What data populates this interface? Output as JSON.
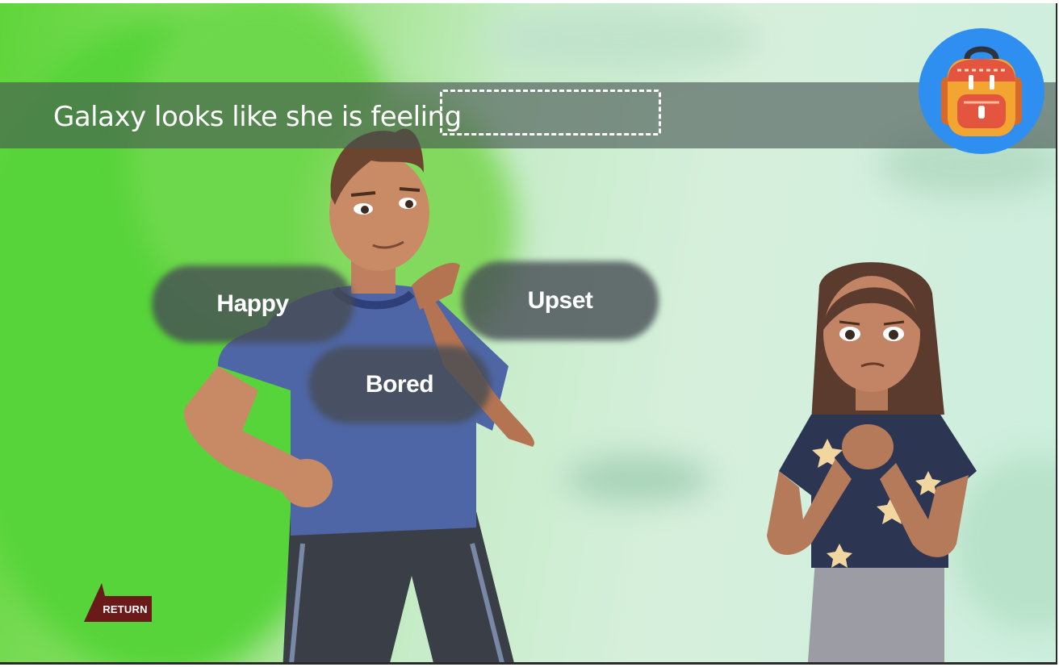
{
  "prompt": {
    "text": "Galaxy looks like she is feeling"
  },
  "choices": [
    {
      "label": "Happy"
    },
    {
      "label": "Upset"
    },
    {
      "label": "Bored"
    }
  ],
  "navigation": {
    "return_label": "RETURN"
  },
  "icons": {
    "backpack": "backpack-icon",
    "return": "return-arrow-icon"
  },
  "colors": {
    "prompt_bar": "#46544f",
    "choice_pill": "#464c54",
    "backpack_circle": "#2e8ff0",
    "return_button": "#6b1a1a"
  }
}
